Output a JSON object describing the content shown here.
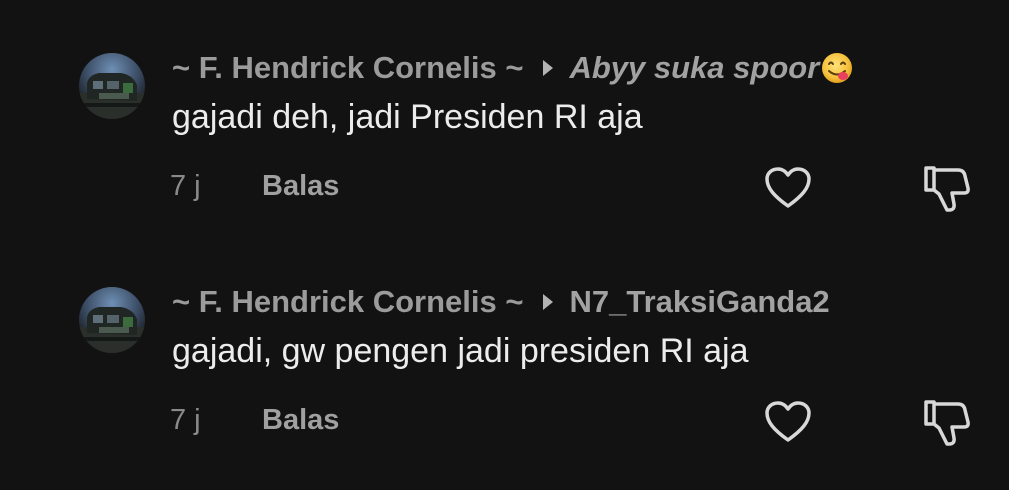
{
  "comments": [
    {
      "author": "~ F. Hendrick Cornelis ~",
      "reply_to": "Abyy suka spoor",
      "reply_to_emoji": "savoring-food-face-icon",
      "text": "gajadi deh, jadi Presiden RI aja",
      "time": "7 j",
      "reply_label": "Balas"
    },
    {
      "author": "~ F. Hendrick Cornelis ~",
      "reply_to": "N7_TraksiGanda2",
      "text": "gajadi, gw pengen jadi presiden RI aja",
      "time": "7 j",
      "reply_label": "Balas"
    }
  ],
  "icons": {
    "reply_arrow": "caret-right-icon",
    "like": "heart-outline-icon",
    "dislike": "thumbs-down-outline-icon"
  },
  "colors": {
    "background": "#121212",
    "author": "#9b9b9b",
    "body_text": "#ececec",
    "meta": "#8a8a8a",
    "icon": "#d8d8d8"
  }
}
